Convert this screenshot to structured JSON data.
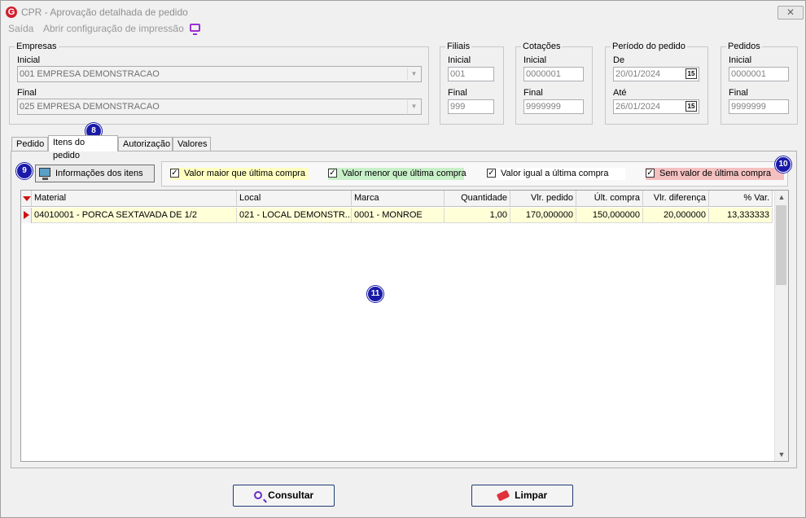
{
  "window": {
    "logo_letter": "G",
    "title": "CPR - Aprovação detalhada de pedido",
    "close_glyph": "✕"
  },
  "menu": {
    "exit": "Saída",
    "print_config": "Abrir configuração de impressão",
    "print_icon": "monitor-icon"
  },
  "filters": {
    "empresas": {
      "legend": "Empresas",
      "initial_label": "Inicial",
      "initial_value": "001 EMPRESA DEMONSTRACAO",
      "final_label": "Final",
      "final_value": "025 EMPRESA DEMONSTRACAO"
    },
    "filiais": {
      "legend": "Filiais",
      "initial_label": "Inicial",
      "initial_value": "001",
      "final_label": "Final",
      "final_value": "999"
    },
    "cotacoes": {
      "legend": "Cotações",
      "initial_label": "Inicial",
      "initial_value": "0000001",
      "final_label": "Final",
      "final_value": "9999999"
    },
    "periodo": {
      "legend": "Período do pedido",
      "from_label": "De",
      "from_value": "20/01/2024",
      "to_label": "Até",
      "to_value": "26/01/2024",
      "calendar_glyph": "15"
    },
    "pedidos": {
      "legend": "Pedidos",
      "initial_label": "Inicial",
      "initial_value": "0000001",
      "final_label": "Final",
      "final_value": "9999999"
    }
  },
  "tabs": [
    "Pedido",
    "Itens do pedido",
    "Autorização",
    "Valores"
  ],
  "badges": {
    "b8": "8",
    "b9": "9",
    "b10": "10",
    "b11": "11"
  },
  "items": {
    "info_button": "Informações dos itens",
    "legend": [
      {
        "label": "Valor maior que última compra",
        "checked": "✓",
        "color": "#ffffc0"
      },
      {
        "label": "Valor menor que última compra",
        "checked": "✓",
        "color": "#c8f0c8"
      },
      {
        "label": "Valor igual a última compra",
        "checked": "✓",
        "color": "#ffffff"
      },
      {
        "label": "Sem valor de última compra",
        "checked": "✓",
        "color": "#f4c0c0"
      }
    ],
    "columns": [
      "Material",
      "Local",
      "Marca",
      "Quantidade",
      "Vlr. pedido",
      "Últ. compra",
      "Vlr. diferença",
      "% Var."
    ],
    "rows": [
      [
        "04010001 - PORCA SEXTAVADA DE  1/2",
        "021 - LOCAL DEMONSTR...",
        "0001 - MONROE",
        "1,00",
        "170,000000",
        "150,000000",
        "20,000000",
        "13,333333"
      ]
    ]
  },
  "buttons": {
    "consultar": "Consultar",
    "limpar": "Limpar"
  }
}
